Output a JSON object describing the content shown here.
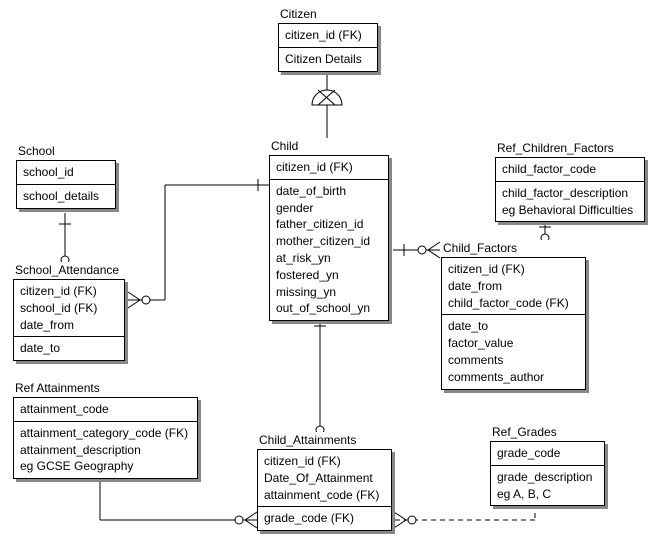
{
  "entities": {
    "citizen": {
      "title": "Citizen",
      "pk": [
        "citizen_id (FK)"
      ],
      "body": [
        "Citizen Details"
      ]
    },
    "school": {
      "title": "School",
      "pk": [
        "school_id"
      ],
      "body": [
        "school_details"
      ]
    },
    "child": {
      "title": "Child",
      "pk": [
        "citizen_id (FK)"
      ],
      "body": [
        "date_of_birth",
        "gender",
        "father_citizen_id",
        "mother_citizen_id",
        "at_risk_yn",
        "fostered_yn",
        "missing_yn",
        "out_of_school_yn"
      ]
    },
    "ref_children_factors": {
      "title": "Ref_Children_Factors",
      "pk": [
        "child_factor_code"
      ],
      "body": [
        "child_factor_description",
        "eg Behavioral Difficulties"
      ]
    },
    "school_attendance": {
      "title": "School_Attendance",
      "pk": [
        "citizen_id (FK)",
        "school_id (FK)",
        "date_from"
      ],
      "body": [
        "date_to"
      ]
    },
    "child_factors": {
      "title": "Child_Factors",
      "pk": [
        "citizen_id (FK)",
        "date_from",
        "child_factor_code (FK)"
      ],
      "body": [
        "date_to",
        "factor_value",
        "comments",
        "comments_author"
      ]
    },
    "ref_attainments": {
      "title": "Ref Attainments",
      "pk": [
        "attainment_code"
      ],
      "body": [
        "attainment_category_code (FK)",
        "attainment_description",
        "eg GCSE Geography"
      ]
    },
    "child_attainments": {
      "title": "Child_Attainments",
      "pk": [
        "citizen_id (FK)",
        "Date_Of_Attainment",
        "attainment_code (FK)"
      ],
      "body": [
        "grade_code (FK)"
      ]
    },
    "ref_grades": {
      "title": "Ref_Grades",
      "pk": [
        "grade_code"
      ],
      "body": [
        "grade_description",
        "eg A, B, C"
      ]
    }
  },
  "chart_data": {
    "type": "er-diagram",
    "entities": [
      {
        "name": "Citizen",
        "pk": [
          "citizen_id (FK)"
        ],
        "attrs": [
          "Citizen Details"
        ]
      },
      {
        "name": "School",
        "pk": [
          "school_id"
        ],
        "attrs": [
          "school_details"
        ]
      },
      {
        "name": "Child",
        "pk": [
          "citizen_id (FK)"
        ],
        "attrs": [
          "date_of_birth",
          "gender",
          "father_citizen_id",
          "mother_citizen_id",
          "at_risk_yn",
          "fostered_yn",
          "missing_yn",
          "out_of_school_yn"
        ]
      },
      {
        "name": "Ref_Children_Factors",
        "pk": [
          "child_factor_code"
        ],
        "attrs": [
          "child_factor_description",
          "eg Behavioral Difficulties"
        ]
      },
      {
        "name": "School_Attendance",
        "pk": [
          "citizen_id (FK)",
          "school_id (FK)",
          "date_from"
        ],
        "attrs": [
          "date_to"
        ]
      },
      {
        "name": "Child_Factors",
        "pk": [
          "citizen_id (FK)",
          "date_from",
          "child_factor_code (FK)"
        ],
        "attrs": [
          "date_to",
          "factor_value",
          "comments",
          "comments_author"
        ]
      },
      {
        "name": "Ref Attainments",
        "pk": [
          "attainment_code"
        ],
        "attrs": [
          "attainment_category_code (FK)",
          "attainment_description",
          "eg GCSE Geography"
        ]
      },
      {
        "name": "Child_Attainments",
        "pk": [
          "citizen_id (FK)",
          "Date_Of_Attainment",
          "attainment_code (FK)"
        ],
        "attrs": [
          "grade_code (FK)"
        ]
      },
      {
        "name": "Ref_Grades",
        "pk": [
          "grade_code"
        ],
        "attrs": [
          "grade_description",
          "eg A, B, C"
        ]
      }
    ],
    "relationships": [
      {
        "from": "Citizen",
        "to": "Child",
        "type": "supertype-subtype"
      },
      {
        "from": "School",
        "to": "School_Attendance",
        "type": "one-to-many",
        "identifying": true
      },
      {
        "from": "Child",
        "to": "School_Attendance",
        "type": "one-to-many",
        "identifying": true
      },
      {
        "from": "Child",
        "to": "Child_Factors",
        "type": "one-to-many",
        "identifying": true
      },
      {
        "from": "Ref_Children_Factors",
        "to": "Child_Factors",
        "type": "one-to-many",
        "identifying": true
      },
      {
        "from": "Child",
        "to": "Child_Attainments",
        "type": "one-to-many",
        "identifying": true
      },
      {
        "from": "Ref Attainments",
        "to": "Child_Attainments",
        "type": "one-to-many",
        "identifying": true
      },
      {
        "from": "Ref_Grades",
        "to": "Child_Attainments",
        "type": "one-to-many",
        "identifying": false
      }
    ]
  }
}
